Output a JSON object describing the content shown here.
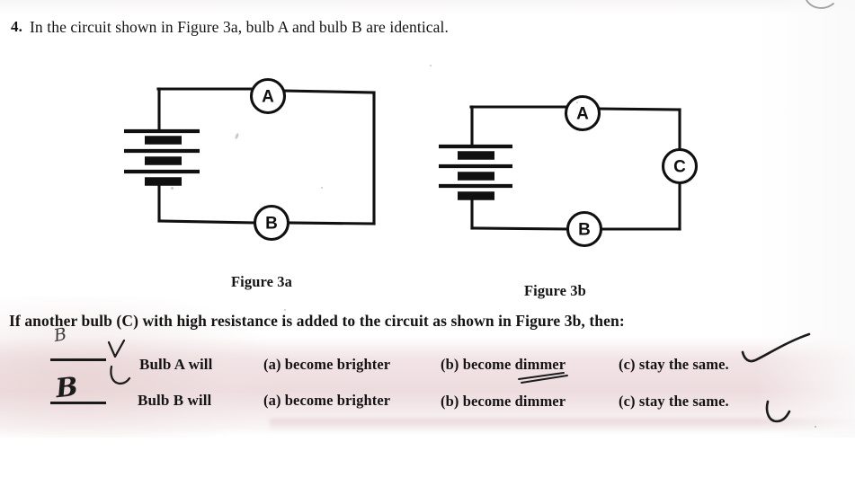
{
  "document": {
    "question_number": "4.",
    "question_stem": "In the circuit shown in Figure 3a, bulb A and bulb B are identical.",
    "follow_up": "If another bulb (C) with high resistance is added to the circuit as shown in Figure 3b, then:"
  },
  "figures": [
    {
      "id": "figure-3a",
      "caption": "Figure 3a",
      "components": [
        {
          "type": "battery",
          "cells": 3,
          "position": "left"
        },
        {
          "type": "bulb",
          "label": "A",
          "position": "top"
        },
        {
          "type": "bulb",
          "label": "B",
          "position": "bottom"
        }
      ]
    },
    {
      "id": "figure-3b",
      "caption": "Figure 3b",
      "components": [
        {
          "type": "battery",
          "cells": 3,
          "position": "left"
        },
        {
          "type": "bulb",
          "label": "A",
          "position": "top"
        },
        {
          "type": "bulb",
          "label": "B",
          "position": "bottom"
        },
        {
          "type": "bulb",
          "label": "C",
          "position": "right"
        }
      ]
    }
  ],
  "bulb_labels": {
    "a": "A",
    "b": "B",
    "c": "C"
  },
  "answer_rows": [
    {
      "prompt": "Bulb A will",
      "options": [
        {
          "key": "(a)",
          "text": "become brighter"
        },
        {
          "key": "(b)",
          "text": "become dimmer"
        },
        {
          "key": "(c)",
          "text": "stay the same."
        }
      ]
    },
    {
      "prompt": "Bulb B will",
      "options": [
        {
          "key": "(a)",
          "text": "become brighter"
        },
        {
          "key": "(b)",
          "text": "become dimmer"
        },
        {
          "key": "(c)",
          "text": "stay the same."
        }
      ]
    }
  ],
  "row1": {
    "prompt": "Bulb A will",
    "opt_a": "(a)  become brighter",
    "opt_b": "(b)  become dimmer",
    "opt_c": "(c)  stay the same."
  },
  "row2": {
    "prompt": "Bulb B will",
    "opt_a": "(a)  become brighter",
    "opt_b": "(b)  become dimmer",
    "opt_c": "(c)  stay the same."
  },
  "handwriting": {
    "mark_above_blank_1": "B",
    "mark_on_blank_2": "B",
    "check_marks": 4,
    "underline_marks": 1
  },
  "colors": {
    "ink": "#101010",
    "paper": "#ffffff",
    "paper_stain": "#e6cdd1",
    "handwriting_ink": "#1b1b1b"
  }
}
